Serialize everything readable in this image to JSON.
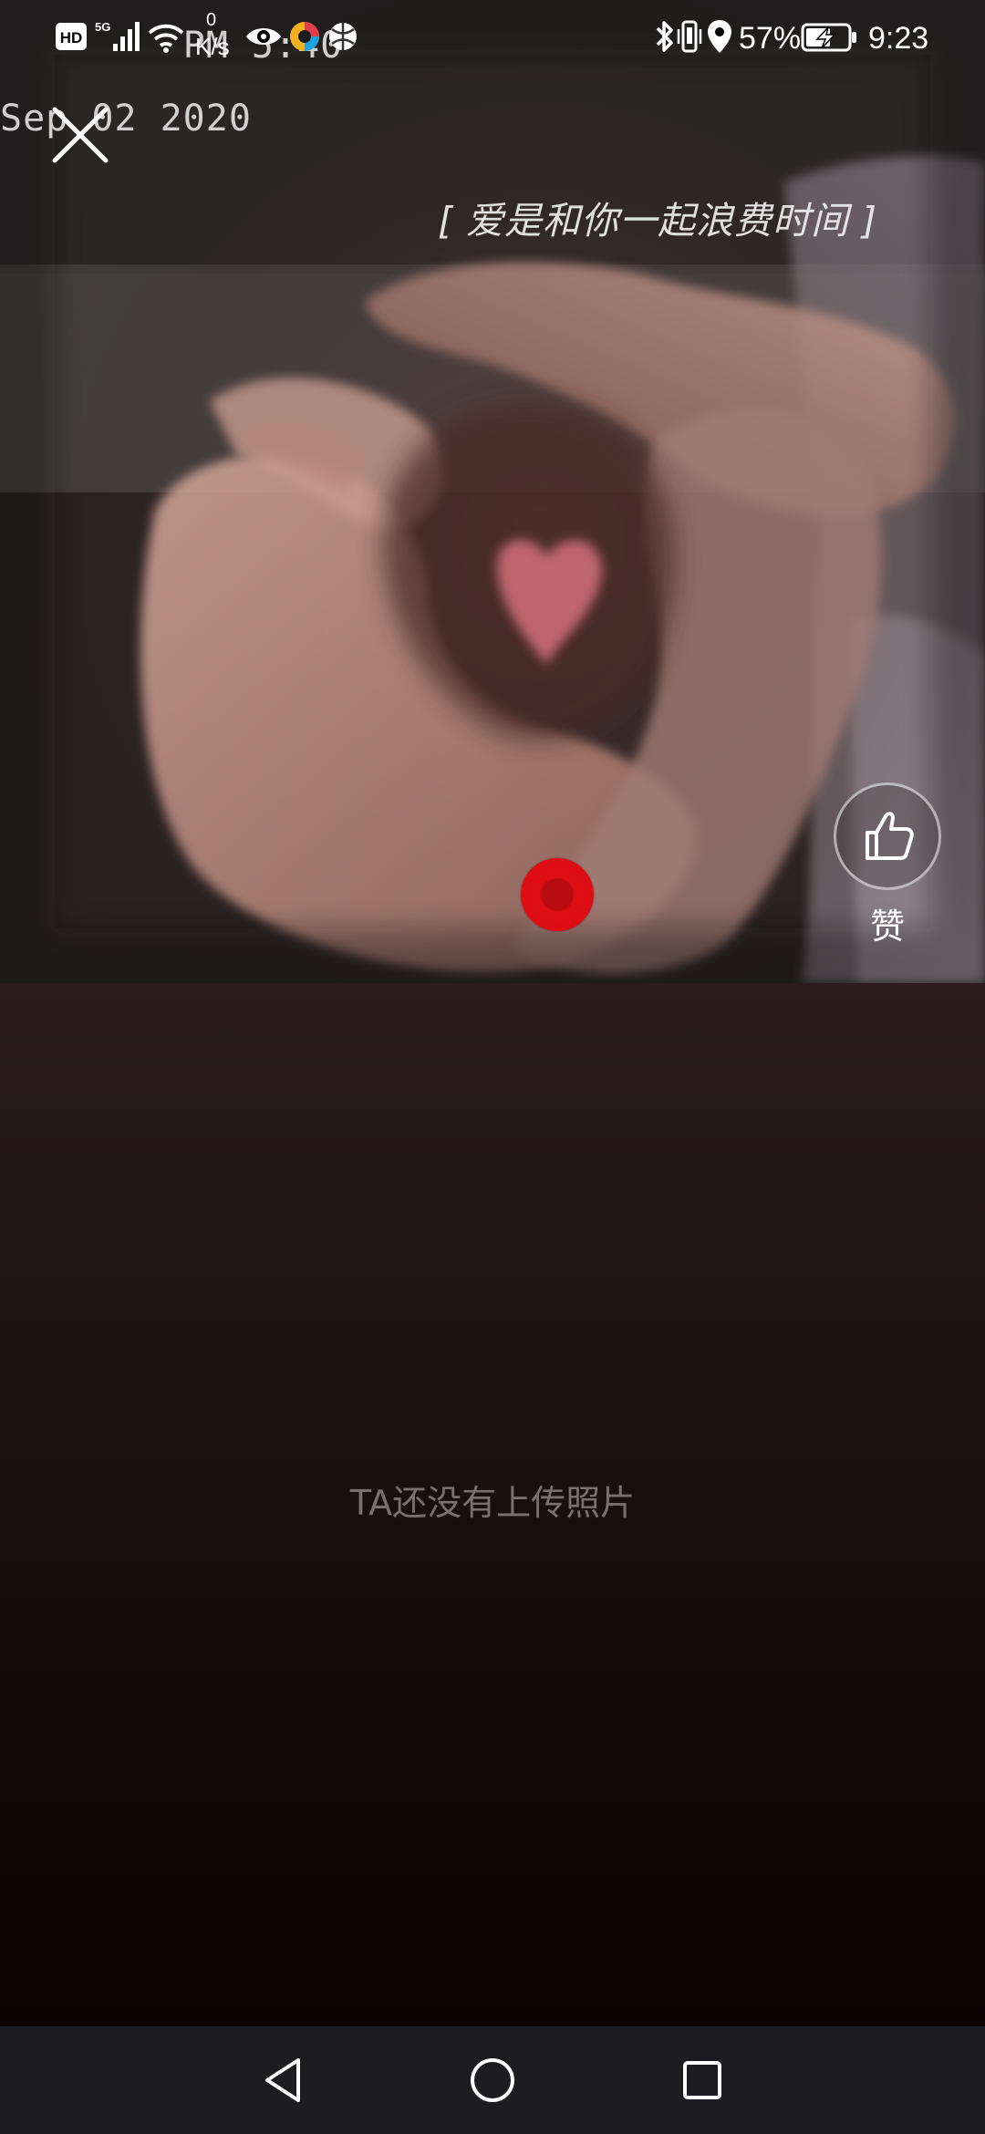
{
  "status_bar": {
    "stamp_line1": "PM 5:40",
    "stamp_line2": "Sep 02 2020",
    "net_speed_value": "0",
    "net_speed_unit": "K/s",
    "battery_percent": "57%",
    "time": "9:23",
    "icons": [
      "hd-icon",
      "5g-signal-icon",
      "wifi-icon",
      "eye-icon",
      "color-app-icon",
      "ball-app-icon",
      "bluetooth-icon",
      "vibrate-icon",
      "location-icon",
      "battery-charging-icon"
    ]
  },
  "viewer": {
    "close_icon": "close-icon",
    "caption": "[ 爱是和你一起浪费时间 ]",
    "like_icon": "thumbs-up-icon",
    "like_label": "赞",
    "empty_message": "TA还没有上传照片"
  },
  "nav": {
    "back_icon": "back-triangle-icon",
    "home_icon": "home-circle-icon",
    "recents_icon": "recents-square-icon"
  },
  "colors": {
    "record_dot": "#e00d14",
    "background_top": "#2b1d1f",
    "background_bottom": "#0a0203",
    "nav_bar": "#1d1c21",
    "empty_text": "#7a6f72"
  }
}
